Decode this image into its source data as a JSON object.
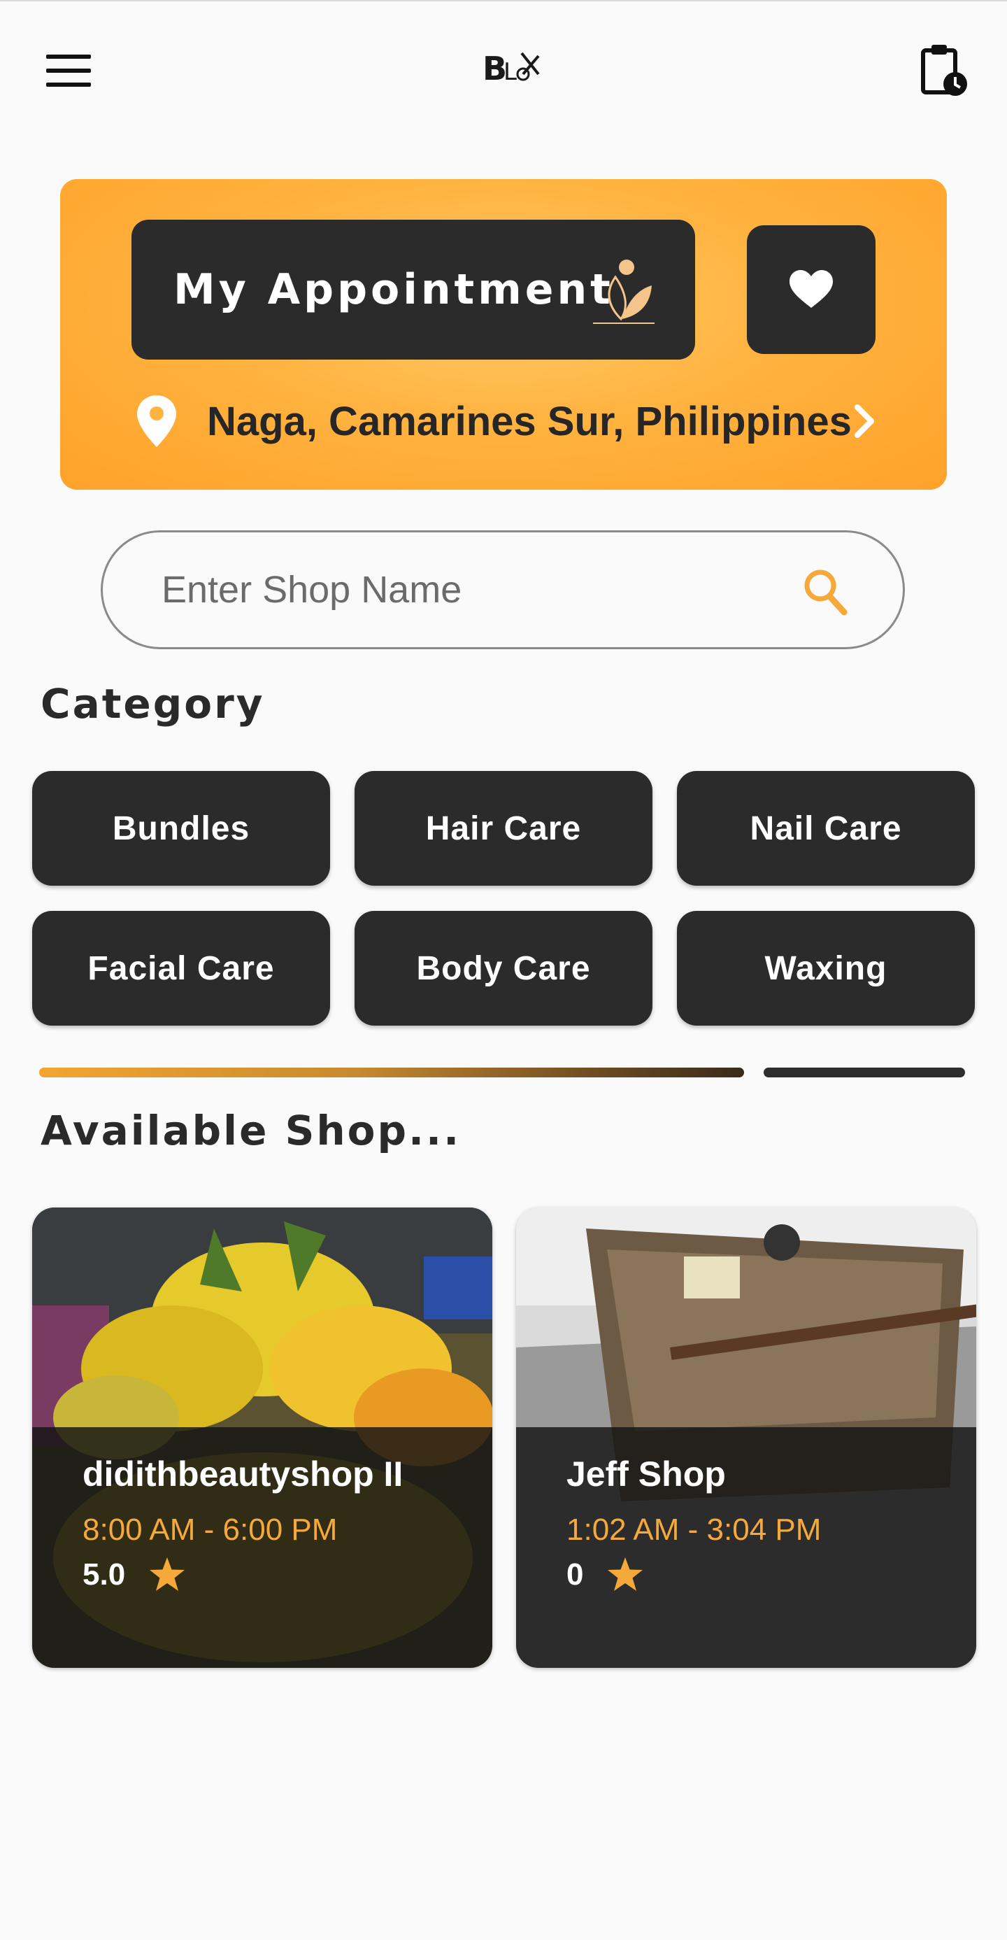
{
  "header": {
    "logo_text": "BLX"
  },
  "banner": {
    "appointment_label": "My Appointment",
    "location": "Naga, Camarines Sur, Philippines"
  },
  "search": {
    "placeholder": "Enter Shop Name"
  },
  "category": {
    "title": "Category",
    "items": [
      "Bundles",
      "Hair Care",
      "Nail Care",
      "Facial Care",
      "Body Care",
      "Waxing"
    ]
  },
  "shops": {
    "title": "Available Shop...",
    "items": [
      {
        "name": "didithbeautyshop II",
        "hours": "8:00 AM - 6:00 PM",
        "rating": "5.0"
      },
      {
        "name": "Jeff Shop",
        "hours": "1:02 AM - 3:04 PM",
        "rating": "0"
      }
    ]
  },
  "colors": {
    "accent": "#ffa22a",
    "dark_button": "#2b2b2b",
    "hours_text": "#f5a93a",
    "background": "#fafafa"
  },
  "icons": [
    "menu-icon",
    "history-clipboard-icon",
    "leaf-icon",
    "heart-icon",
    "location-pin-icon",
    "chevron-right-icon",
    "search-icon",
    "star-icon"
  ]
}
